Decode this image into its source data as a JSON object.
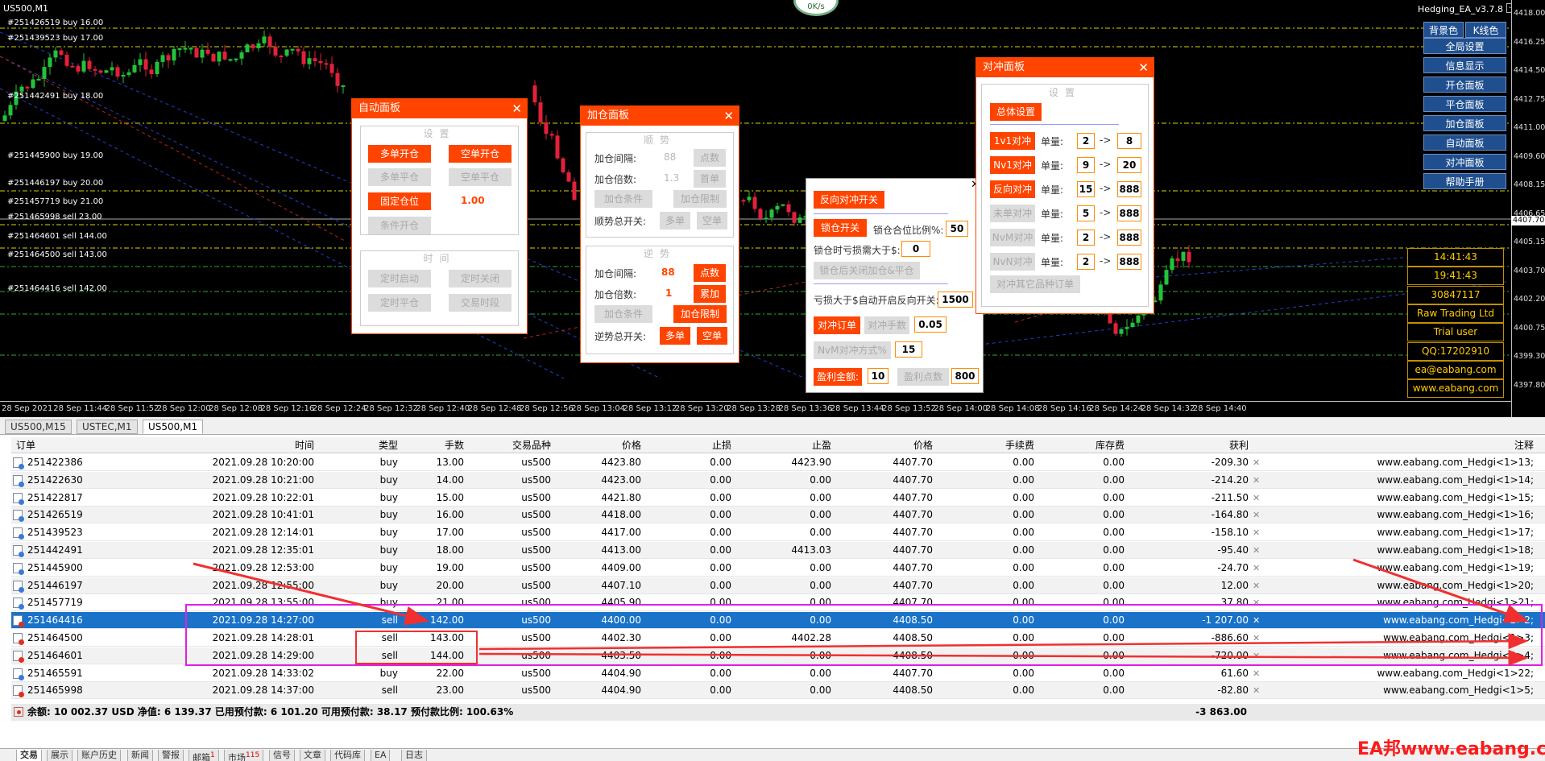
{
  "chart": {
    "symbol_title": "US500,M1",
    "ea_title": "Hedging_EA_v3.7.8",
    "speed": "0K/s",
    "level_labels": [
      "#251426519 buy 16.00",
      "#251439523 buy 17.00",
      "#251442491 buy 18.00",
      "#251445900 buy 19.00",
      "#251446197 buy 20.00",
      "#251457719 buy 21.00",
      "#251465998 sell 23.00",
      "#251464601 sell 144.00",
      "#251464500 sell 143.00",
      "#251464416 sell 142.00"
    ],
    "price_ticks": [
      "4418.00",
      "4416.25",
      "4414.50",
      "4412.75",
      "4411.00",
      "4409.60",
      "4408.15",
      "4406.65",
      "4405.15",
      "4403.70",
      "4402.20",
      "4400.75",
      "4399.30",
      "4397.80"
    ],
    "price_badge": "4407.70",
    "time_ticks": [
      "28 Sep 2021",
      "28 Sep 11:44",
      "28 Sep 11:52",
      "28 Sep 12:00",
      "28 Sep 12:08",
      "28 Sep 12:16",
      "28 Sep 12:24",
      "28 Sep 12:32",
      "28 Sep 12:40",
      "28 Sep 12:48",
      "28 Sep 12:56",
      "28 Sep 13:04",
      "28 Sep 13:12",
      "28 Sep 13:20",
      "28 Sep 13:28",
      "28 Sep 13:36",
      "28 Sep 13:44",
      "28 Sep 13:52",
      "28 Sep 14:00",
      "28 Sep 14:08",
      "28 Sep 14:16",
      "28 Sep 14:24",
      "28 Sep 14:32",
      "28 Sep 14:40"
    ]
  },
  "auto_panel": {
    "title": "自动面板",
    "close": "✕",
    "settings_title": "设置",
    "buy_open": "多单开仓",
    "sell_open": "空单开仓",
    "buy_close": "多单平仓",
    "sell_close": "空单平仓",
    "fixed_lot": "固定仓位",
    "fixed_lot_value": "1.00",
    "cond_open": "条件开仓",
    "time_title": "时间",
    "timer_start": "定时启动",
    "timer_stop": "定时关闭",
    "timer_close": "定时平仓",
    "trade_time": "交易时段"
  },
  "add_panel": {
    "title": "加仓面板",
    "close": "✕",
    "trend_title": "顺势",
    "interval_label": "加仓间隔:",
    "interval_value": "88",
    "points": "点数",
    "multiple_label": "加仓倍数:",
    "multiple_value": "1.3",
    "first_lot": "首单",
    "add_cond": "加仓条件",
    "add_limit": "加仓限制",
    "trend_switch": "顺势总开关:",
    "buy": "多单",
    "sell": "空单",
    "counter_title": "逆势",
    "c_interval_label": "加仓间隔:",
    "c_interval_value": "88",
    "c_points": "点数",
    "c_multiple_label": "加仓倍数:",
    "c_multiple_value": "1",
    "c_accum": "累加",
    "c_add_cond": "加仓条件",
    "c_add_limit": "加仓限制",
    "counter_switch": "逆势总开关:",
    "c_buy": "多单",
    "c_sell": "空单"
  },
  "reverse_panel": {
    "close": "✕",
    "reverse_switch": "反向对冲开关",
    "lock_switch": "锁仓开关",
    "lock_ratio_label": "锁仓合位比例%:",
    "lock_ratio": "50",
    "lock_loss_label": "锁仓时亏损需大于$:",
    "lock_loss": "0",
    "lock_after": "锁仓后关闭加仓&平仓",
    "loss_label": "亏损大于$自动开启反向开关:",
    "loss_value": "1500",
    "hedge_order": "对冲订单",
    "hedge_lots": "对冲手数",
    "hedge_lots_value": "0.05",
    "nvm_mode": "NvM对冲方式%",
    "nvm_value": "15",
    "profit_amount": "盈利金额:",
    "profit_value": "10",
    "profit_points": "盈利点数",
    "profit_points_value": "800"
  },
  "hedge_panel": {
    "title": "对冲面板",
    "close": "✕",
    "settings_title": "设置",
    "global_settings": "总体设置",
    "lot_label": "单量:",
    "arrow": "->",
    "rows": [
      {
        "name": "1v1对冲",
        "from": "2",
        "to": "8",
        "enabled": true
      },
      {
        "name": "Nv1对冲",
        "from": "9",
        "to": "20",
        "enabled": true
      },
      {
        "name": "反向对冲",
        "from": "15",
        "to": "888",
        "enabled": true
      },
      {
        "name": "未单对冲",
        "from": "5",
        "to": "888",
        "enabled": false
      },
      {
        "name": "NvM对冲",
        "from": "2",
        "to": "888",
        "enabled": false
      },
      {
        "name": "NvN对冲",
        "from": "2",
        "to": "888",
        "enabled": false
      }
    ],
    "other_symbols": "对冲其它品种订单"
  },
  "right_menu": [
    "全局设置",
    "信息显示",
    "开仓面板",
    "平仓面板",
    "加仓面板",
    "自动面板",
    "对冲面板",
    "帮助手册"
  ],
  "right_top": {
    "bg_color": "背景色",
    "kline_color": "K线色"
  },
  "info_box": [
    "14:41:43",
    "19:41:43",
    "30847117",
    "Raw Trading Ltd",
    "Trial user",
    "QQ:17202910",
    "ea@eabang.com",
    "www.eabang.com"
  ],
  "chart_tabs": [
    "US500,M15",
    "USTEC,M1",
    "US500,M1"
  ],
  "table": {
    "headers": [
      "订单",
      "时间",
      "类型",
      "手数",
      "交易品种",
      "价格",
      "止损",
      "止盈",
      "价格",
      "手续费",
      "库存费",
      "获利",
      "注释"
    ],
    "rows": [
      {
        "order": "251422386",
        "time": "2021.09.28 10:20:00",
        "type": "buy",
        "lots": "13.00",
        "symbol": "us500",
        "price": "4423.80",
        "sl": "0.00",
        "tp": "4423.90",
        "cur": "4407.70",
        "fee": "0.00",
        "swap": "0.00",
        "profit": "-209.30",
        "comment": "www.eabang.com_Hedgi<1>13;"
      },
      {
        "order": "251422630",
        "time": "2021.09.28 10:21:00",
        "type": "buy",
        "lots": "14.00",
        "symbol": "us500",
        "price": "4423.00",
        "sl": "0.00",
        "tp": "0.00",
        "cur": "4407.70",
        "fee": "0.00",
        "swap": "0.00",
        "profit": "-214.20",
        "comment": "www.eabang.com_Hedgi<1>14;"
      },
      {
        "order": "251422817",
        "time": "2021.09.28 10:22:01",
        "type": "buy",
        "lots": "15.00",
        "symbol": "us500",
        "price": "4421.80",
        "sl": "0.00",
        "tp": "0.00",
        "cur": "4407.70",
        "fee": "0.00",
        "swap": "0.00",
        "profit": "-211.50",
        "comment": "www.eabang.com_Hedgi<1>15;"
      },
      {
        "order": "251426519",
        "time": "2021.09.28 10:41:01",
        "type": "buy",
        "lots": "16.00",
        "symbol": "us500",
        "price": "4418.00",
        "sl": "0.00",
        "tp": "0.00",
        "cur": "4407.70",
        "fee": "0.00",
        "swap": "0.00",
        "profit": "-164.80",
        "comment": "www.eabang.com_Hedgi<1>16;"
      },
      {
        "order": "251439523",
        "time": "2021.09.28 12:14:01",
        "type": "buy",
        "lots": "17.00",
        "symbol": "us500",
        "price": "4417.00",
        "sl": "0.00",
        "tp": "0.00",
        "cur": "4407.70",
        "fee": "0.00",
        "swap": "0.00",
        "profit": "-158.10",
        "comment": "www.eabang.com_Hedgi<1>17;"
      },
      {
        "order": "251442491",
        "time": "2021.09.28 12:35:01",
        "type": "buy",
        "lots": "18.00",
        "symbol": "us500",
        "price": "4413.00",
        "sl": "0.00",
        "tp": "4413.03",
        "cur": "4407.70",
        "fee": "0.00",
        "swap": "0.00",
        "profit": "-95.40",
        "comment": "www.eabang.com_Hedgi<1>18;"
      },
      {
        "order": "251445900",
        "time": "2021.09.28 12:53:00",
        "type": "buy",
        "lots": "19.00",
        "symbol": "us500",
        "price": "4409.00",
        "sl": "0.00",
        "tp": "0.00",
        "cur": "4407.70",
        "fee": "0.00",
        "swap": "0.00",
        "profit": "-24.70",
        "comment": "www.eabang.com_Hedgi<1>19;"
      },
      {
        "order": "251446197",
        "time": "2021.09.28 12:55:00",
        "type": "buy",
        "lots": "20.00",
        "symbol": "us500",
        "price": "4407.10",
        "sl": "0.00",
        "tp": "0.00",
        "cur": "4407.70",
        "fee": "0.00",
        "swap": "0.00",
        "profit": "12.00",
        "comment": "www.eabang.com_Hedgi<1>20;"
      },
      {
        "order": "251457719",
        "time": "2021.09.28 13:55:00",
        "type": "buy",
        "lots": "21.00",
        "symbol": "us500",
        "price": "4405.90",
        "sl": "0.00",
        "tp": "0.00",
        "cur": "4407.70",
        "fee": "0.00",
        "swap": "0.00",
        "profit": "37.80",
        "comment": "www.eabang.com_Hedgi<1>21;"
      },
      {
        "order": "251464416",
        "time": "2021.09.28 14:27:00",
        "type": "sell",
        "lots": "142.00",
        "symbol": "us500",
        "price": "4400.00",
        "sl": "0.00",
        "tp": "0.00",
        "cur": "4408.50",
        "fee": "0.00",
        "swap": "0.00",
        "profit": "-1 207.00",
        "comment": "www.eabang.com_Hedgi<2>2;"
      },
      {
        "order": "251464500",
        "time": "2021.09.28 14:28:01",
        "type": "sell",
        "lots": "143.00",
        "symbol": "us500",
        "price": "4402.30",
        "sl": "0.00",
        "tp": "4402.28",
        "cur": "4408.50",
        "fee": "0.00",
        "swap": "0.00",
        "profit": "-886.60",
        "comment": "www.eabang.com_Hedgi<1>3;"
      },
      {
        "order": "251464601",
        "time": "2021.09.28 14:29:00",
        "type": "sell",
        "lots": "144.00",
        "symbol": "us500",
        "price": "4403.50",
        "sl": "0.00",
        "tp": "0.00",
        "cur": "4408.50",
        "fee": "0.00",
        "swap": "0.00",
        "profit": "-720.00",
        "comment": "www.eabang.com_Hedgi<1>4;"
      },
      {
        "order": "251465591",
        "time": "2021.09.28 14:33:02",
        "type": "buy",
        "lots": "22.00",
        "symbol": "us500",
        "price": "4404.90",
        "sl": "0.00",
        "tp": "0.00",
        "cur": "4407.70",
        "fee": "0.00",
        "swap": "0.00",
        "profit": "61.60",
        "comment": "www.eabang.com_Hedgi<1>22;"
      },
      {
        "order": "251465998",
        "time": "2021.09.28 14:37:00",
        "type": "sell",
        "lots": "23.00",
        "symbol": "us500",
        "price": "4404.90",
        "sl": "0.00",
        "tp": "0.00",
        "cur": "4408.50",
        "fee": "0.00",
        "swap": "0.00",
        "profit": "-82.80",
        "comment": "www.eabang.com_Hedgi<1>5;"
      }
    ],
    "selected_index": 9,
    "summary_text": "余额: 10 002.37 USD  净值: 6 139.37  已用预付款: 6 101.20  可用预付款: 38.17  预付款比例: 100.63%",
    "summary_profit": "-3 863.00"
  },
  "side_close": "✕",
  "bottom_tabs": [
    {
      "label": "交易",
      "badge": ""
    },
    {
      "label": "展示",
      "badge": ""
    },
    {
      "label": "账户历史",
      "badge": ""
    },
    {
      "label": "新闻",
      "badge": ""
    },
    {
      "label": "警报",
      "badge": ""
    },
    {
      "label": "邮箱",
      "badge": "1"
    },
    {
      "label": "市场",
      "badge": "115"
    },
    {
      "label": "信号",
      "badge": ""
    },
    {
      "label": "文章",
      "badge": ""
    },
    {
      "label": "代码库",
      "badge": ""
    },
    {
      "label": "EA",
      "badge": ""
    },
    {
      "label": "日志",
      "badge": ""
    }
  ],
  "watermark": "EA邦www.eabang.com",
  "colors": {
    "accent": "#ff4400",
    "selected_row": "#1a73c8",
    "menu_blue": "#1f4f8f",
    "info_gold": "#ffcc00"
  }
}
